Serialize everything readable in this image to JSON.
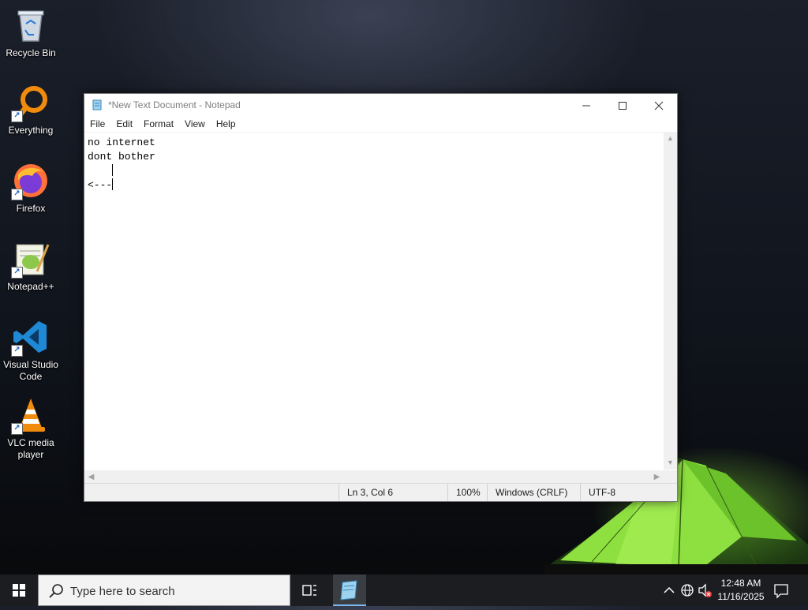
{
  "desktop": {
    "icons": [
      {
        "label": "Recycle Bin"
      },
      {
        "label": "Everything"
      },
      {
        "label": "Firefox"
      },
      {
        "label": "Notepad++"
      },
      {
        "label": "Visual Studio Code"
      },
      {
        "label": "VLC media player"
      }
    ]
  },
  "notepad": {
    "title": "*New Text Document - Notepad",
    "menu": [
      "File",
      "Edit",
      "Format",
      "View",
      "Help"
    ],
    "content": {
      "line1": "no internet",
      "line2": "dont bother",
      "line3": "    ",
      "line4": "<---"
    },
    "status": {
      "position": "Ln 3, Col 6",
      "zoom": "100%",
      "line_ending": "Windows (CRLF)",
      "encoding": "UTF-8"
    }
  },
  "taskbar": {
    "search_placeholder": "Type here to search",
    "clock_time": "12:48 AM",
    "clock_date": "11/16/2025"
  },
  "colors": {
    "taskbar_bg": "#1b1d21",
    "active_underline": "#7fb6f0",
    "vscode_blue": "#1e8ad6",
    "vlc_orange": "#f08b0c"
  }
}
